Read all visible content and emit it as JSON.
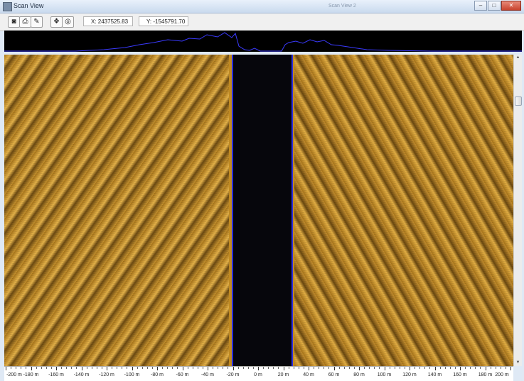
{
  "window": {
    "title": "Scan View",
    "ghost_title": "Scan View 2",
    "controls": {
      "minimize": "–",
      "maximize": "□",
      "close": "✕"
    }
  },
  "toolbar": {
    "buttons": [
      {
        "icon": "camera-icon",
        "glyph": "◙"
      },
      {
        "icon": "printer-icon",
        "glyph": "⎙"
      },
      {
        "icon": "pen-icon",
        "glyph": "✎"
      },
      {
        "icon": "layers-icon",
        "glyph": "❖"
      },
      {
        "icon": "target-icon",
        "glyph": "◎"
      }
    ],
    "x_readout": "X: 2437525.83",
    "y_readout": "Y: -1545791.70"
  },
  "colors": {
    "sonar_amber": "#c08a22",
    "water_column": "#06060c",
    "bottom_track_blue": "#2b2ee0",
    "signal_trace_blue": "#3a3aff"
  },
  "range_scale": {
    "unit": "m",
    "labels": [
      "-200 m",
      "-180 m",
      "-160 m",
      "-140 m",
      "-120 m",
      "-100 m",
      "-80 m",
      "-60 m",
      "-40 m",
      "-20 m",
      "0 m",
      "20 m",
      "40 m",
      "60 m",
      "80 m",
      "100 m",
      "120 m",
      "140 m",
      "160 m",
      "180 m",
      "200 m"
    ]
  }
}
